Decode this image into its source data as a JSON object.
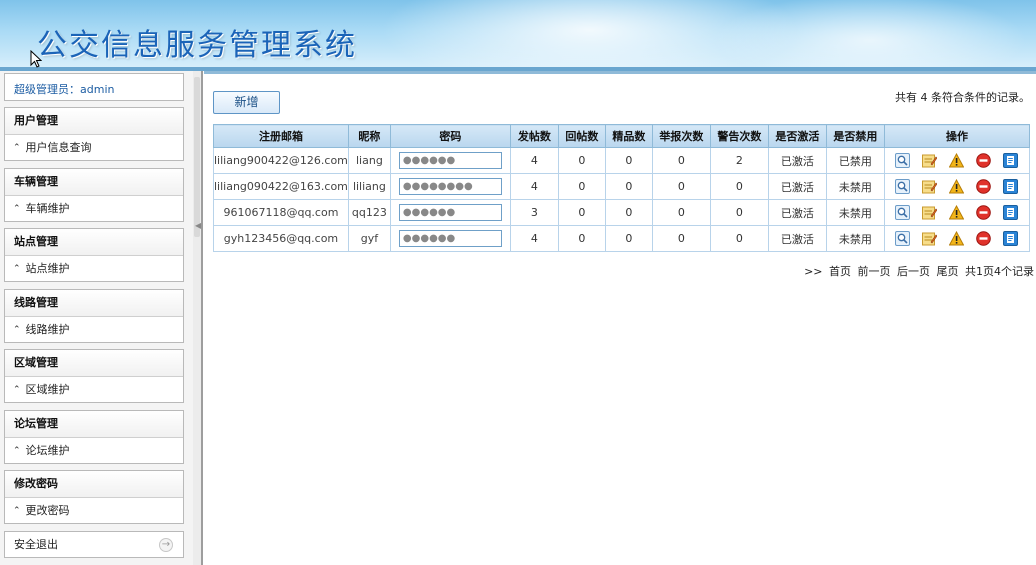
{
  "header": {
    "title": "公交信息服务管理系统"
  },
  "sidebar": {
    "admin_label": "超级管理员：",
    "admin_name": "admin",
    "groups": [
      {
        "title": "用户管理",
        "item": "用户信息查询"
      },
      {
        "title": "车辆管理",
        "item": "车辆维护"
      },
      {
        "title": "站点管理",
        "item": "站点维护"
      },
      {
        "title": "线路管理",
        "item": "线路维护"
      },
      {
        "title": "区域管理",
        "item": "区域维护"
      },
      {
        "title": "论坛管理",
        "item": "论坛维护"
      },
      {
        "title": "修改密码",
        "item": "更改密码"
      }
    ],
    "logout": "安全退出"
  },
  "main": {
    "add_button": "新增",
    "record_info": "共有  4 条符合条件的记录。",
    "columns": [
      "注册邮箱",
      "昵称",
      "密码",
      "发帖数",
      "回帖数",
      "精品数",
      "举报次数",
      "警告次数",
      "是否激活",
      "是否禁用",
      "操作"
    ],
    "rows": [
      {
        "email": "liliang900422@126.com",
        "nick": "liang",
        "password": "●●●●●●",
        "posts": "4",
        "replies": "0",
        "featured": "0",
        "reports": "0",
        "warnings": "2",
        "activated": "已激活",
        "banned": "已禁用"
      },
      {
        "email": "liliang090422@163.com",
        "nick": "liliang",
        "password": "●●●●●●●●",
        "posts": "4",
        "replies": "0",
        "featured": "0",
        "reports": "0",
        "warnings": "0",
        "activated": "已激活",
        "banned": "未禁用"
      },
      {
        "email": "961067118@qq.com",
        "nick": "qq123",
        "password": "●●●●●●",
        "posts": "3",
        "replies": "0",
        "featured": "0",
        "reports": "0",
        "warnings": "0",
        "activated": "已激活",
        "banned": "未禁用"
      },
      {
        "email": "gyh123456@qq.com",
        "nick": "gyf",
        "password": "●●●●●●",
        "posts": "4",
        "replies": "0",
        "featured": "0",
        "reports": "0",
        "warnings": "0",
        "activated": "已激活",
        "banned": "未禁用"
      }
    ],
    "pager": {
      "prefix": ">>",
      "first": "首页",
      "prev": "前一页",
      "next": "后一页",
      "last": "尾页",
      "summary": "共1页4个记录"
    }
  },
  "colors": {
    "accent": "#1d5da3",
    "danger": "#d40000",
    "header_border": "#8fbad8"
  },
  "icons": [
    "view-icon",
    "edit-icon",
    "warning-icon",
    "ban-icon",
    "document-icon"
  ]
}
